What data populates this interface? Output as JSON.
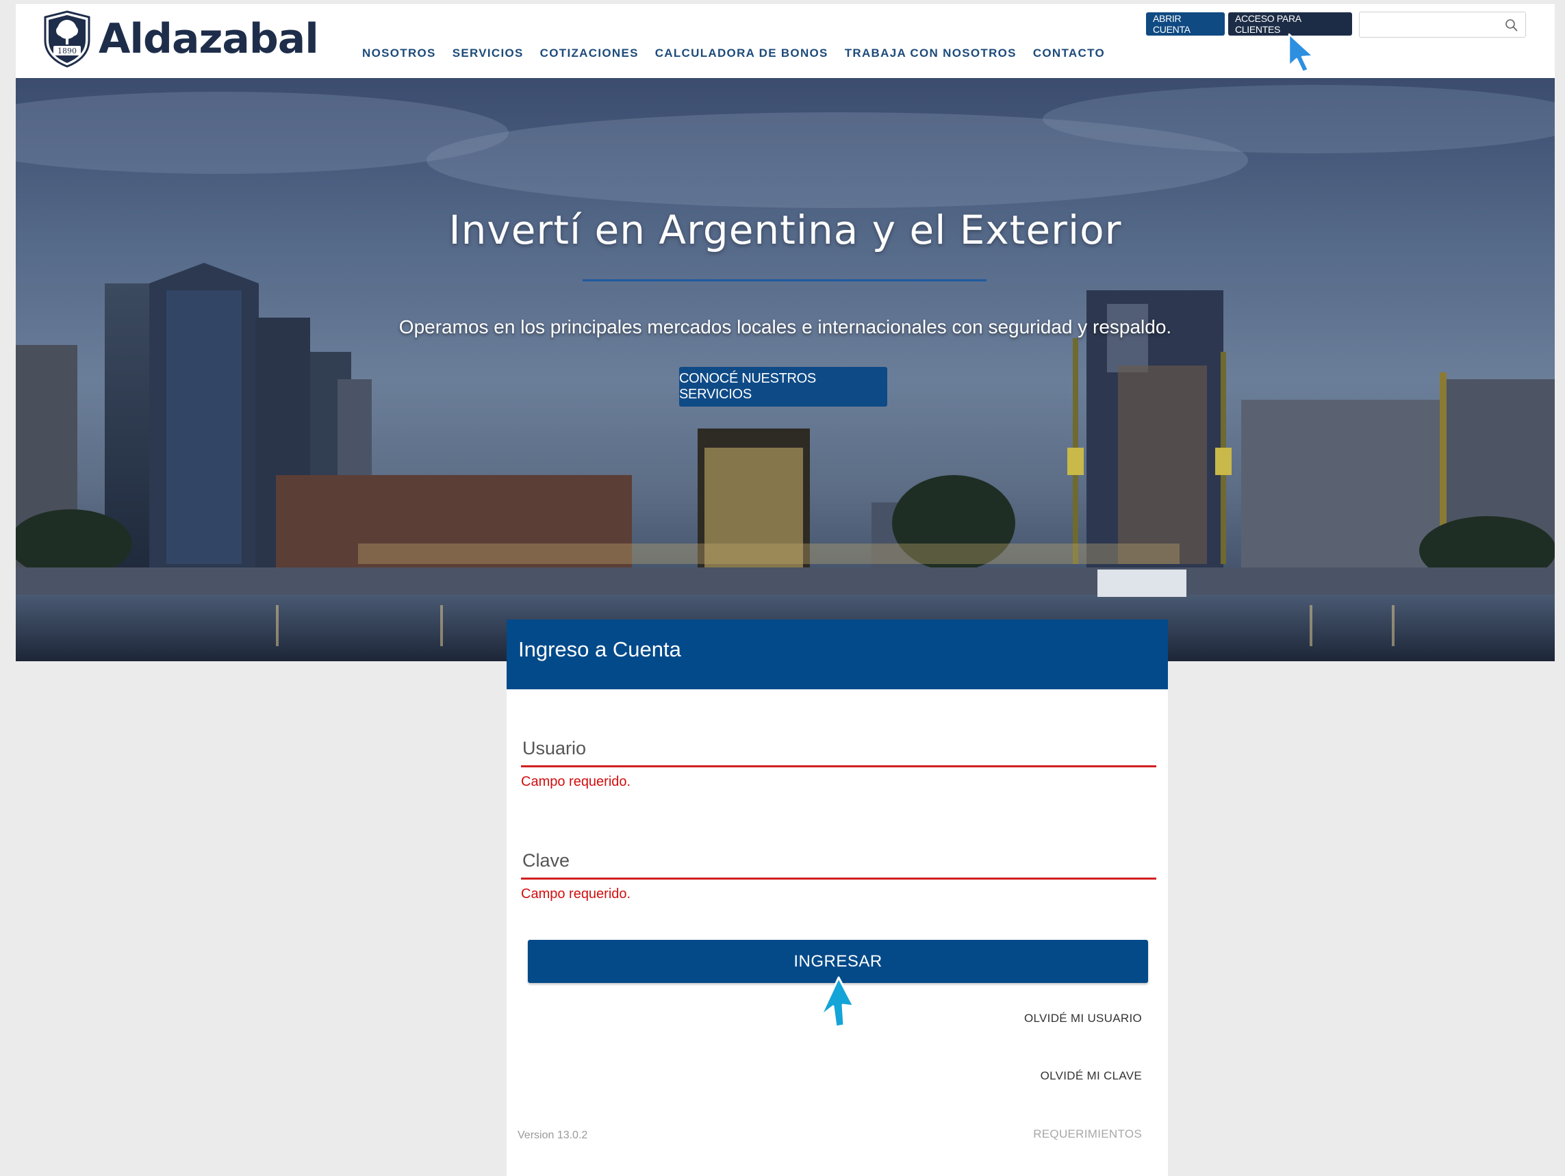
{
  "header": {
    "logo_text": "Aldazabal",
    "logo_badge_year": "1890",
    "nav": [
      "NOSOTROS",
      "SERVICIOS",
      "COTIZACIONES",
      "CALCULADORA DE BONOS",
      "TRABAJA CON NOSOTROS",
      "CONTACTO"
    ],
    "abrir_cuenta": "ABRIR CUENTA",
    "acceso_clientes": "ACCESO PARA CLIENTES",
    "search_placeholder": ""
  },
  "hero": {
    "title": "Invertí en Argentina y el Exterior",
    "subtitle": "Operamos en los principales mercados locales e internacionales con seguridad y respaldo.",
    "cta": "CONOCÉ NUESTROS SERVICIOS"
  },
  "login": {
    "title": "Ingreso a Cuenta",
    "usuario_label": "Usuario",
    "usuario_error": "Campo requerido.",
    "clave_label": "Clave",
    "clave_error": "Campo requerido.",
    "submit": "INGRESAR",
    "forgot_user": "OLVIDÉ MI USUARIO",
    "forgot_password": "OLVIDÉ MI CLAVE",
    "version": "Version 13.0.2",
    "requirements": "REQUERIMIENTOS"
  },
  "colors": {
    "brand_navy": "#1e2d4a",
    "primary_blue": "#034a8a",
    "error_red": "#d12020",
    "cursor_blue": "#2d8fe0"
  },
  "icons": [
    "logo-shield-icon",
    "search-icon",
    "cursor-arrow-icon",
    "cursor-touch-icon"
  ]
}
